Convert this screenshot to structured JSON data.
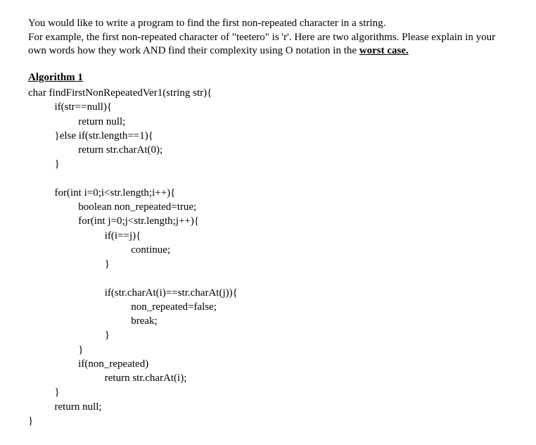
{
  "intro": {
    "line1": "You would like to write a program to find the first non-repeated character in a string.",
    "line2_part1": "For example, the first non-repeated character of \"teetero\" is 'r'. Here are two algorithms. Please explain in your own words how they work AND find their complexity using O notation in the ",
    "line2_bold": "worst case."
  },
  "algorithm": {
    "title": "Algorithm 1",
    "code": "char findFirstNonRepeatedVer1(string str){\n          if(str==null){\n                   return null;\n          }else if(str.length==1){\n                   return str.charAt(0);\n          }\n\n          for(int i=0;i<str.length;i++){\n                   boolean non_repeated=true;\n                   for(int j=0;j<str.length;j++){\n                             if(i==j){\n                                       continue;\n                             }\n\n                             if(str.charAt(i)==str.charAt(j)){\n                                       non_repeated=false;\n                                       break;\n                             }\n                   }\n                   if(non_repeated)\n                             return str.charAt(i);\n          }\n          return null;\n}"
  }
}
